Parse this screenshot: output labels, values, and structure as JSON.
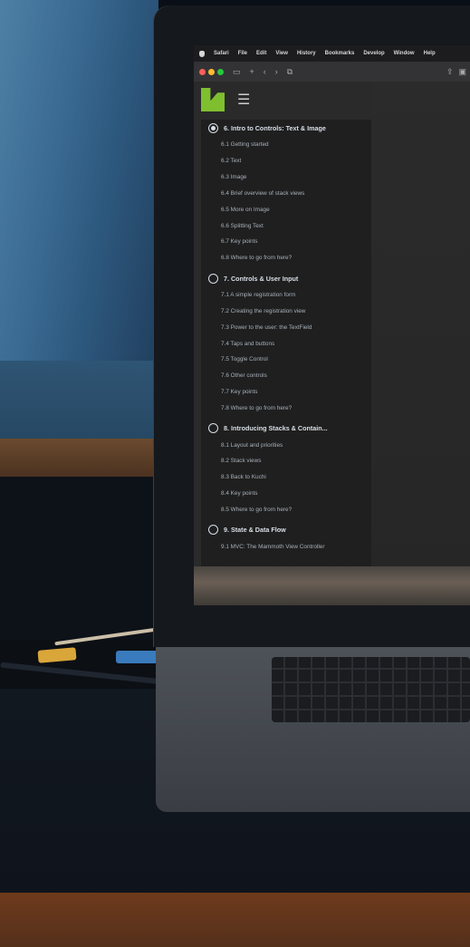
{
  "menubar": {
    "items": [
      "Safari",
      "File",
      "Edit",
      "View",
      "History",
      "Bookmarks",
      "Develop",
      "Window",
      "Help"
    ]
  },
  "toc": {
    "chapters": [
      {
        "title": "6. Intro to Controls: Text & Image",
        "sections": [
          "6.1 Getting started",
          "6.2 Text",
          "6.3 Image",
          "6.4 Brief overview of stack views",
          "6.5 More on Image",
          "6.6 Splitting Text",
          "6.7 Key points",
          "6.8 Where to go from here?"
        ]
      },
      {
        "title": "7. Controls & User Input",
        "sections": [
          "7.1 A simple registration form",
          "7.2 Creating the registration view",
          "7.3 Power to the user: the TextField",
          "7.4 Taps and buttons",
          "7.5 Toggle Control",
          "7.6 Other controls",
          "7.7 Key points",
          "7.8 Where to go from here?"
        ]
      },
      {
        "title": "8. Introducing Stacks & Contain...",
        "sections": [
          "8.1 Layout and priorities",
          "8.2 Stack views",
          "8.3 Back to Kuchi",
          "8.4 Key points",
          "8.5 Where to go from here?"
        ]
      },
      {
        "title": "9. State & Data Flow",
        "sections": [
          "9.1 MVC: The Mammoth View Controller"
        ]
      }
    ]
  }
}
